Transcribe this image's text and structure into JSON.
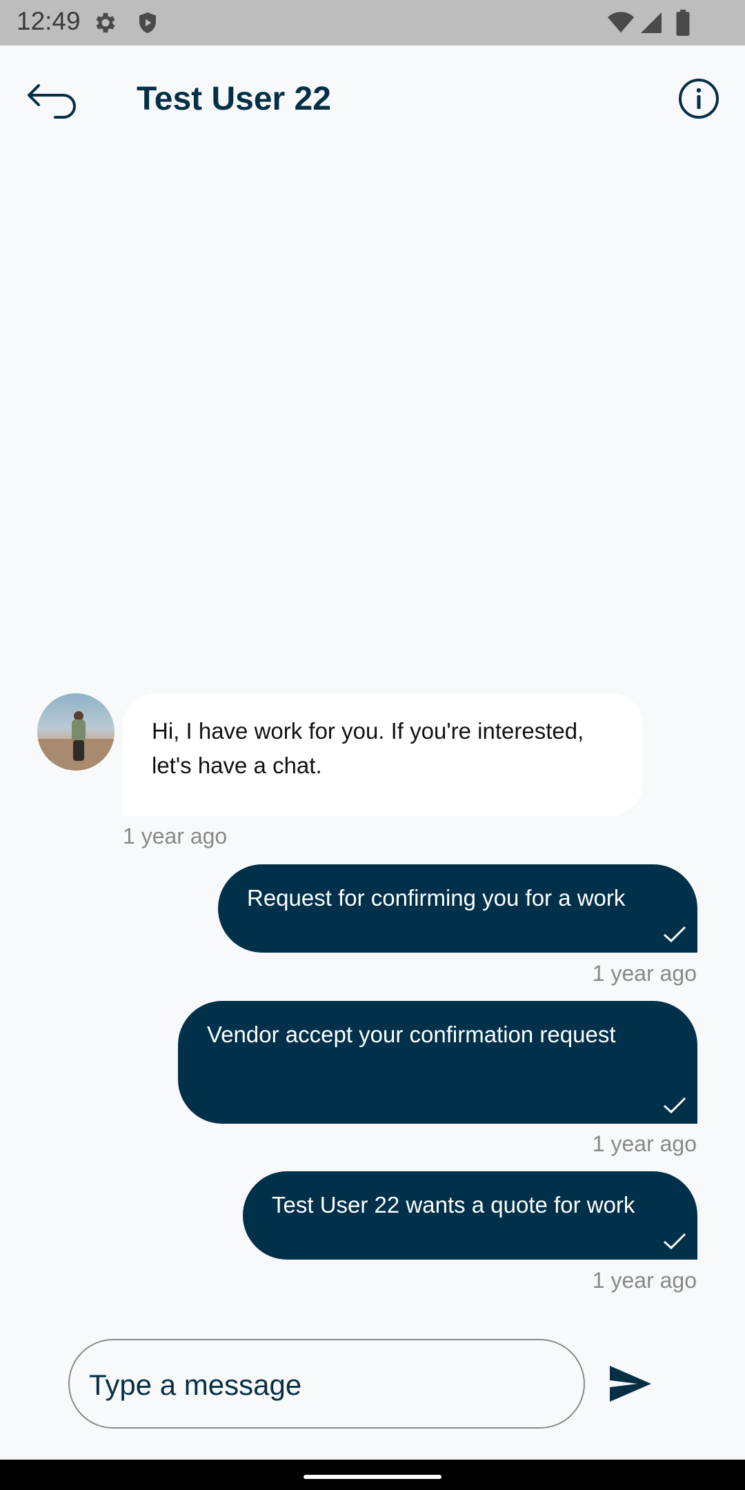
{
  "status_bar": {
    "time": "12:49",
    "icons": [
      "settings-icon",
      "shield-icon",
      "wifi-icon",
      "signal-icon",
      "battery-icon"
    ]
  },
  "header": {
    "title": "Test User 22",
    "back_icon": "back-arrow-icon",
    "info_icon": "info-icon"
  },
  "messages": [
    {
      "direction": "incoming",
      "text": "Hi, I have work for you. If you're interested, let's have a chat.",
      "time": "1 year ago"
    },
    {
      "direction": "outgoing",
      "text": "Request for confirming you for a work",
      "time": "1 year ago",
      "status": "check-icon"
    },
    {
      "direction": "outgoing",
      "text": "Vendor accept your confirmation request",
      "time": "1 year ago",
      "status": "check-icon"
    },
    {
      "direction": "outgoing",
      "text": "Test User 22 wants a quote for work",
      "time": "1 year ago",
      "status": "check-icon"
    }
  ],
  "composer": {
    "placeholder": "Type a message",
    "value": "",
    "send_icon": "send-icon"
  },
  "colors": {
    "accent": "#00304a",
    "title": "#052f45",
    "background": "#f8f9fa",
    "incoming_bubble": "#ffffff",
    "timestamp": "#888888"
  }
}
